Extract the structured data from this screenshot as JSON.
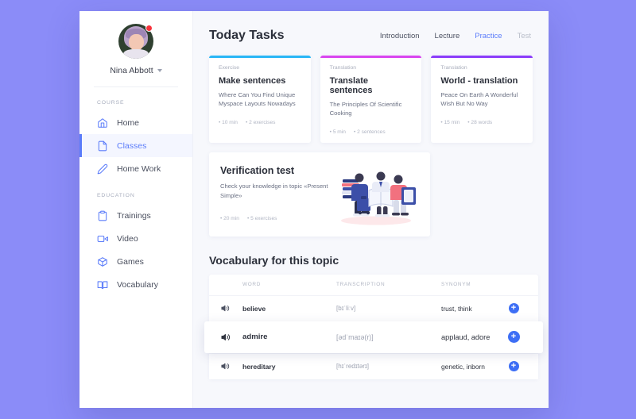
{
  "theme": {
    "page_background": "#8b8cf8",
    "accent_blue": "#5b7cfa",
    "panel_background": "#f7f8fc",
    "card_background": "#ffffff"
  },
  "sidebar": {
    "profile": {
      "name": "Nina Abbott",
      "avatar_icon": "user-avatar",
      "notification_icon": "notification-dot",
      "dropdown_icon": "chevron-down-icon"
    },
    "sections": [
      {
        "label": "COURSE",
        "items": [
          {
            "label": "Home",
            "icon": "home-icon",
            "active": false
          },
          {
            "label": "Classes",
            "icon": "document-icon",
            "active": true
          },
          {
            "label": "Home Work",
            "icon": "pencil-icon",
            "active": false
          }
        ]
      },
      {
        "label": "EDUCATION",
        "items": [
          {
            "label": "Trainings",
            "icon": "clipboard-icon",
            "active": false
          },
          {
            "label": "Video",
            "icon": "video-camera-icon",
            "active": false
          },
          {
            "label": "Games",
            "icon": "cube-icon",
            "active": false
          },
          {
            "label": "Vocabulary",
            "icon": "book-icon",
            "active": false
          }
        ]
      }
    ]
  },
  "main": {
    "page_title": "Today Tasks",
    "tabs": [
      {
        "label": "Introduction",
        "state": "default"
      },
      {
        "label": "Lecture",
        "state": "default"
      },
      {
        "label": "Practice",
        "state": "active"
      },
      {
        "label": "Test",
        "state": "muted"
      }
    ],
    "task_cards": [
      {
        "accent_color": "#29b6f6",
        "category": "Exercise",
        "title": "Make sentences",
        "description": "Where Can You Find Unique Myspace Layouts Nowadays",
        "meta_duration": "10 min",
        "meta_count": "2 exercises"
      },
      {
        "accent_color": "#d946ef",
        "category": "Translation",
        "title": "Translate sentences",
        "description": "The Principles Of Scientific Cooking",
        "meta_duration": "5 min",
        "meta_count": "2 sentences"
      },
      {
        "accent_color": "#8b3dfa",
        "category": "Translation",
        "title": "World - translation",
        "description": "Peace On Earth A Wonderful Wish But No Way",
        "meta_duration": "15 min",
        "meta_count": "28 words"
      }
    ],
    "verification": {
      "title": "Verification test",
      "description": "Check your knowledge in topic «Present Simple»",
      "meta_duration": "20 min",
      "meta_count": "5 exercises",
      "illustration_icon": "people-with-books-illustration"
    },
    "vocabulary": {
      "title": "Vocabulary for this topic",
      "columns": [
        "WORD",
        "TRANSCRIPTION",
        "SYNONYM"
      ],
      "speaker_icon": "speaker-icon",
      "add_icon": "plus-circle-icon",
      "rows": [
        {
          "word": "believe",
          "transcription": "[bɪˈliːv]",
          "synonym": "trust, think",
          "highlighted": false
        },
        {
          "word": "admire",
          "transcription": "[ədˈmaɪə(r)]",
          "synonym": "applaud, adore",
          "highlighted": true
        },
        {
          "word": "hereditary",
          "transcription": "[hɪˈredɪtərɪ]",
          "synonym": "genetic, inborn",
          "highlighted": false
        }
      ]
    }
  }
}
